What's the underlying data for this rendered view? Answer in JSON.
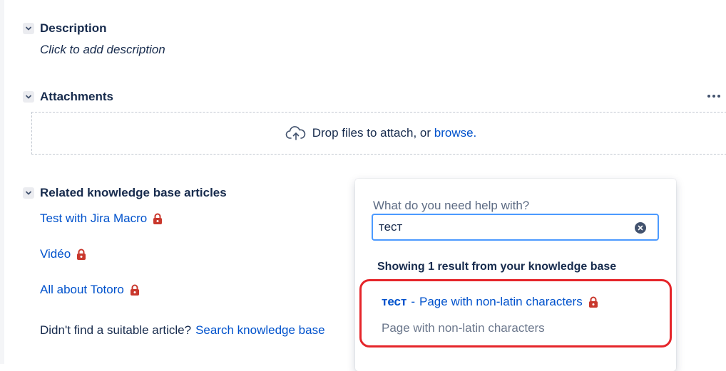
{
  "description": {
    "title": "Description",
    "placeholder": "Click to add description"
  },
  "attachments": {
    "title": "Attachments",
    "more_icon": "more-horizontal-icon",
    "dropzone_text": "Drop files to attach, or",
    "browse_link": "browse."
  },
  "related_kb": {
    "title": "Related knowledge base articles",
    "articles": [
      {
        "label": "Test with Jira Macro",
        "restricted": true
      },
      {
        "label": "Vidéo",
        "restricted": true
      },
      {
        "label": "All about Totoro",
        "restricted": true
      }
    ],
    "help_prompt": "Didn't find a suitable article?",
    "search_link": "Search knowledge base"
  },
  "kb_popup": {
    "label": "What do you need help with?",
    "query": "тест",
    "results_heading": "Showing 1 result from your knowledge base",
    "result": {
      "term": "тест",
      "separator": "-",
      "title": "Page with non-latin characters",
      "excerpt": "Page with non-latin characters",
      "restricted": true
    }
  },
  "colors": {
    "link": "#0052cc",
    "lock": "#c9372c",
    "input_focus": "#4c9aff",
    "highlight_ring": "#e5252a"
  }
}
